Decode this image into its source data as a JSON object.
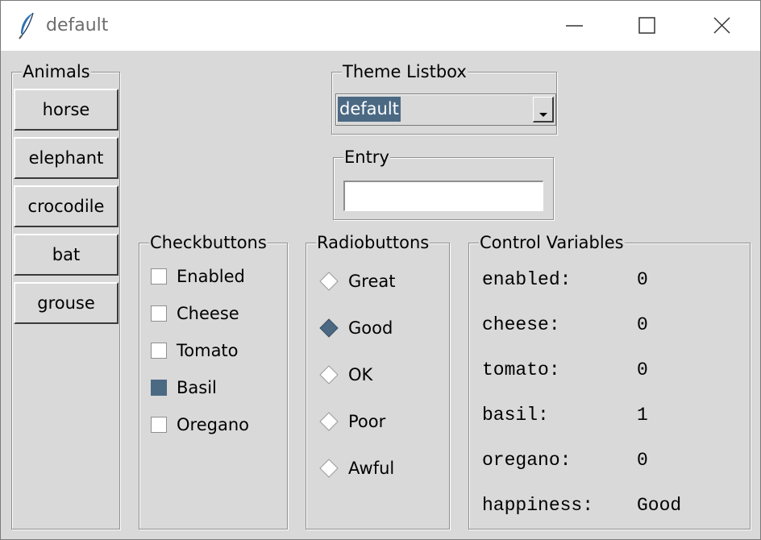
{
  "window": {
    "title": "default"
  },
  "animals": {
    "legend": "Animals",
    "buttons": [
      "horse",
      "elephant",
      "crocodile",
      "bat",
      "grouse"
    ]
  },
  "theme": {
    "legend": "Theme Listbox",
    "selected": "default"
  },
  "entry": {
    "legend": "Entry",
    "value": ""
  },
  "checkbuttons": {
    "legend": "Checkbuttons",
    "items": [
      {
        "label": "Enabled",
        "checked": false
      },
      {
        "label": "Cheese",
        "checked": false
      },
      {
        "label": "Tomato",
        "checked": false
      },
      {
        "label": "Basil",
        "checked": true
      },
      {
        "label": "Oregano",
        "checked": false
      }
    ]
  },
  "radiobuttons": {
    "legend": "Radiobuttons",
    "items": [
      {
        "label": "Great",
        "selected": false
      },
      {
        "label": "Good",
        "selected": true
      },
      {
        "label": "OK",
        "selected": false
      },
      {
        "label": "Poor",
        "selected": false
      },
      {
        "label": "Awful",
        "selected": false
      }
    ]
  },
  "variables": {
    "legend": "Control Variables",
    "rows": [
      {
        "name": "enabled:",
        "value": "0"
      },
      {
        "name": "cheese:",
        "value": "0"
      },
      {
        "name": "tomato:",
        "value": "0"
      },
      {
        "name": "basil:",
        "value": "1"
      },
      {
        "name": "oregano:",
        "value": "0"
      },
      {
        "name": "happiness:",
        "value": "Good"
      }
    ]
  },
  "colors": {
    "accent": "#4b6983",
    "background": "#d9d9d9"
  }
}
